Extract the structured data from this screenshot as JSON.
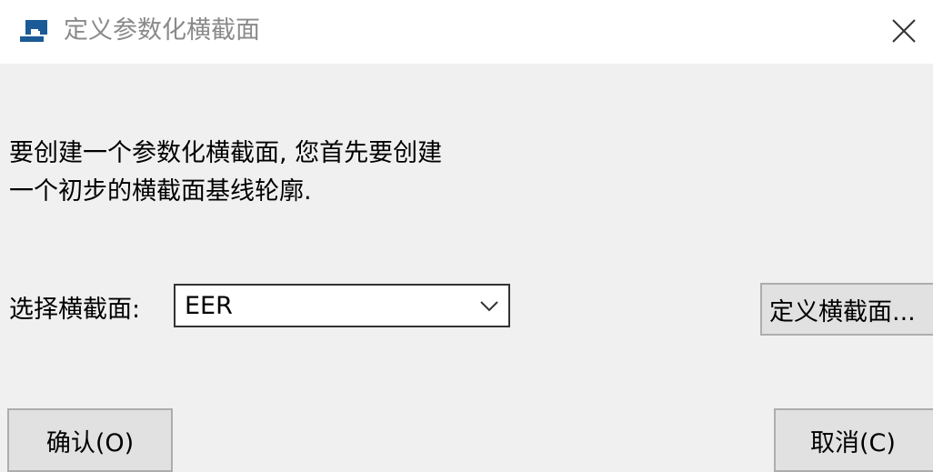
{
  "window": {
    "title": "定义参数化横截面",
    "app_icon": "app-window-icon",
    "close_icon": "close-icon"
  },
  "message": {
    "line1": "要创建一个参数化横截面, 您首先要创建",
    "line2": "一个初步的横截面基线轮廓."
  },
  "section_select": {
    "label": "选择横截面:",
    "value": "EER",
    "chevron_icon": "chevron-down-icon"
  },
  "buttons": {
    "define": "定义横截面...",
    "ok": "确认(O)",
    "cancel": "取消(C)"
  },
  "colors": {
    "title_text": "#8a8a8a",
    "icon_blue": "#1a5a96",
    "dialog_bg": "#f0f0f0",
    "button_bg": "#e1e1e1",
    "button_border": "#adadad"
  }
}
